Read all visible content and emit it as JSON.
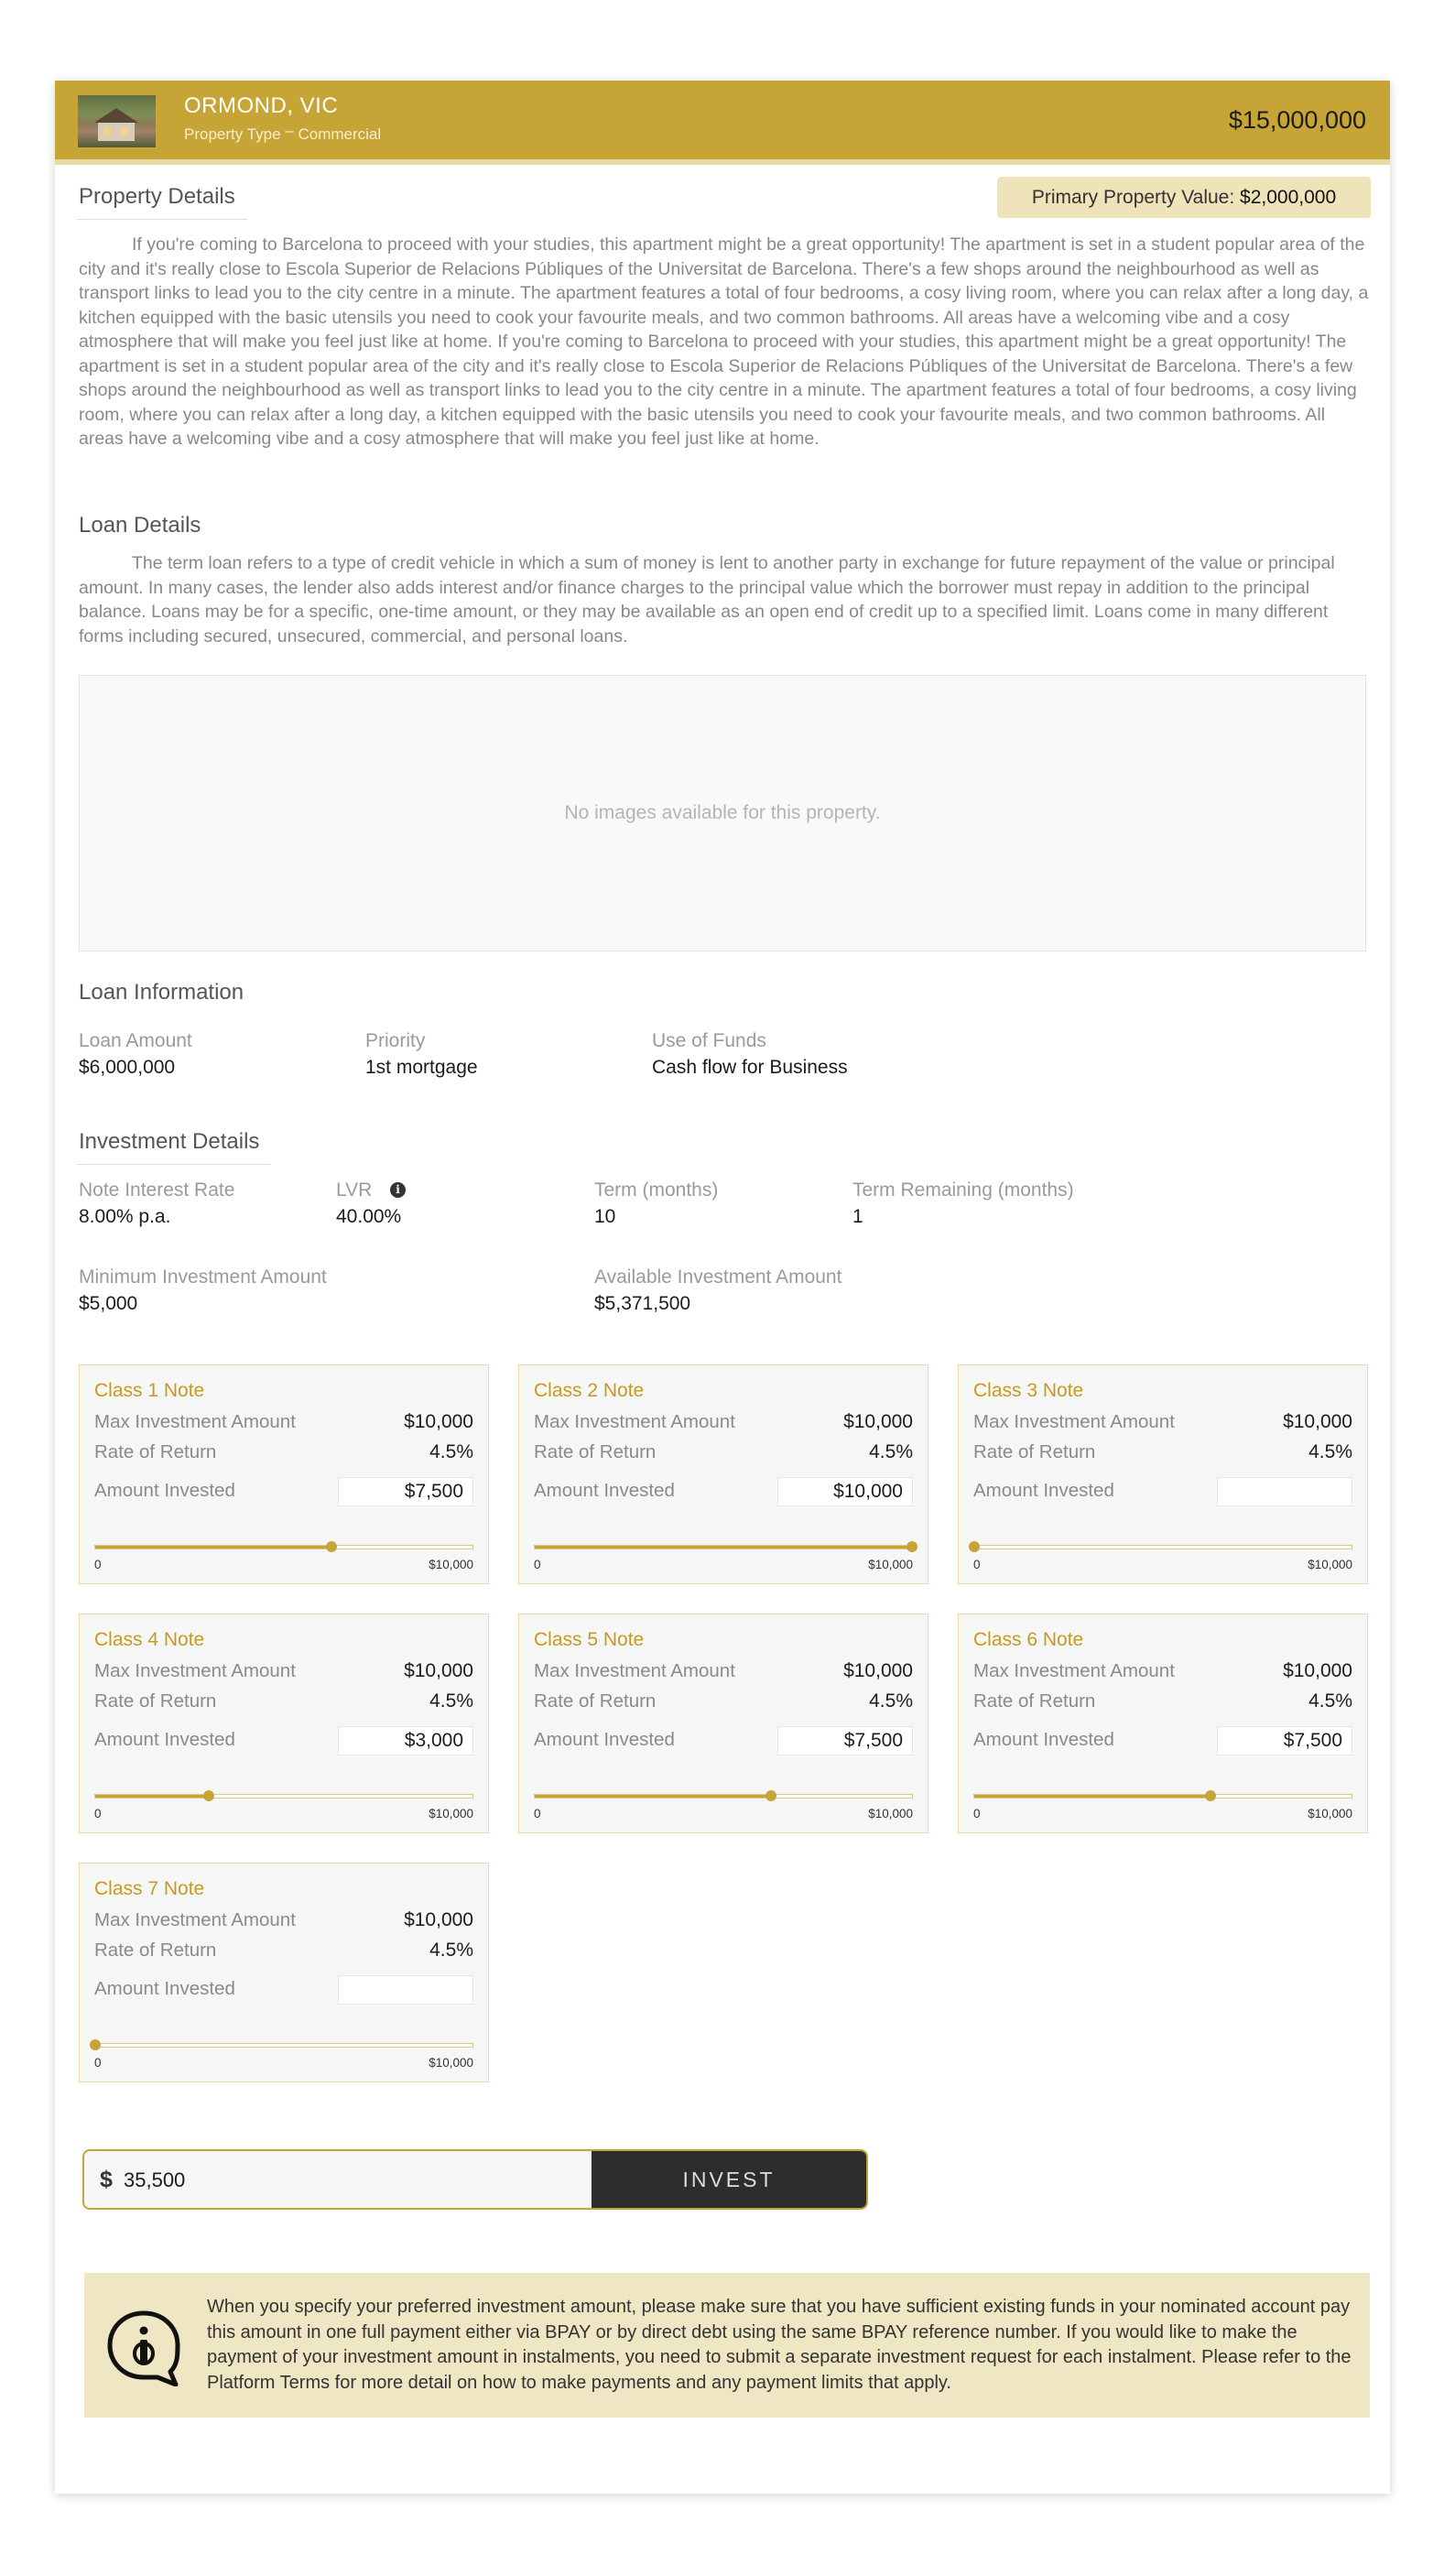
{
  "header": {
    "location": "ORMOND, VIC",
    "property_type_label": "Property Type",
    "property_type_sep": "–",
    "property_type": "Commercial",
    "price": "$15,000,000"
  },
  "property_details": {
    "title": "Property Details",
    "primary_value_label": "Primary Property Value:",
    "primary_value": "$2,000,000",
    "description": "If you're coming to Barcelona to proceed with your studies, this apartment might be a great opportunity! The apartment is set in a student popular area of the city and it's really close to Escola Superior de Relacions Públiques of the Universitat de Barcelona. There's a few shops around the neighbourhood as well as transport links to lead you to the city centre in a minute. The apartment features a total of four bedrooms, a cosy living room, where you can relax after a long day, a kitchen equipped with the basic utensils you need to cook your favourite meals, and two common bathrooms. All areas have a welcoming vibe and a cosy atmosphere that will make you feel just like at home. If you're coming to Barcelona to proceed with your studies, this apartment might be a great opportunity! The apartment is set in a student popular area of the city and it's really close to Escola Superior de Relacions Públiques of the Universitat de Barcelona. There's a few shops around the neighbourhood as well as transport links to lead you to the city centre in a minute. The apartment features a total of four bedrooms, a cosy living room, where you can relax after a long day, a kitchen equipped with the basic utensils you need to cook your favourite meals, and two common bathrooms. All areas have a welcoming vibe and a cosy atmosphere that will make you feel just like at home."
  },
  "loan_details": {
    "title": "Loan Details",
    "description": "The term loan refers to a type of credit vehicle in which a sum of money is lent to another party in exchange for future repayment of the value or principal amount. In many cases, the lender also adds interest and/or finance charges to the principal value which the borrower must repay in addition to the principal balance. Loans may be for a specific, one-time amount, or they may be available as an  open end of credit up to a specified limit. Loans come in many different forms including secured, unsecured, commercial, and personal loans."
  },
  "images": {
    "empty_text": "No images available for this property."
  },
  "loan_information": {
    "title": "Loan Information",
    "loan_amount_label": "Loan Amount",
    "loan_amount": "$6,000,000",
    "priority_label": "Priority",
    "priority": "1st mortgage",
    "use_of_funds_label": "Use of Funds",
    "use_of_funds": "Cash flow for Business"
  },
  "investment_details": {
    "title": "Investment Details",
    "interest_rate_label": "Note Interest Rate",
    "interest_rate": "8.00% p.a.",
    "lvr_label": "LVR",
    "lvr": "40.00%",
    "term_label": "Term (months)",
    "term": "10",
    "term_remaining_label": "Term Remaining (months)",
    "term_remaining": "1",
    "min_investment_label": "Minimum Investment Amount",
    "min_investment": "$5,000",
    "available_label": "Available Investment Amount",
    "available": "$5,371,500"
  },
  "note_labels": {
    "max": "Max Investment Amount",
    "rate": "Rate of Return",
    "invested": "Amount Invested",
    "slider_min": "0",
    "slider_max": "$10,000"
  },
  "notes": [
    {
      "title": "Class 1 Note",
      "max": "$10,000",
      "rate": "4.5%",
      "invested": "$7,500",
      "fraction": 0.625
    },
    {
      "title": "Class 2 Note",
      "max": "$10,000",
      "rate": "4.5%",
      "invested": "$10,000",
      "fraction": 1.0
    },
    {
      "title": "Class 3 Note",
      "max": "$10,000",
      "rate": "4.5%",
      "invested": "",
      "fraction": 0.0
    },
    {
      "title": "Class 4 Note",
      "max": "$10,000",
      "rate": "4.5%",
      "invested": "$3,000",
      "fraction": 0.3
    },
    {
      "title": "Class 5 Note",
      "max": "$10,000",
      "rate": "4.5%",
      "invested": "$7,500",
      "fraction": 0.625
    },
    {
      "title": "Class 6 Note",
      "max": "$10,000",
      "rate": "4.5%",
      "invested": "$7,500",
      "fraction": 0.625
    },
    {
      "title": "Class 7 Note",
      "max": "$10,000",
      "rate": "4.5%",
      "invested": "",
      "fraction": 0.0
    }
  ],
  "invest": {
    "currency": "$",
    "amount": "35,500",
    "button_label": "INVEST"
  },
  "notice": {
    "text": "When you specify your preferred investment amount, please make sure that you have sufficient existing funds in your nominated account pay this amount in one full payment either via BPAY or by direct debt using the same BPAY reference number. If you would like to make the payment of your investment amount in instalments, you need to submit a separate investment request for each instalment. Please refer to the Platform Terms for more detail on how to make payments and any payment limits that apply."
  },
  "colors": {
    "brand_gold": "#c6a536",
    "note_title": "#c59b1e",
    "badge_bg": "#efe3b9",
    "notice_bg": "#efe6c3",
    "button_dark": "#2d2d2d"
  }
}
